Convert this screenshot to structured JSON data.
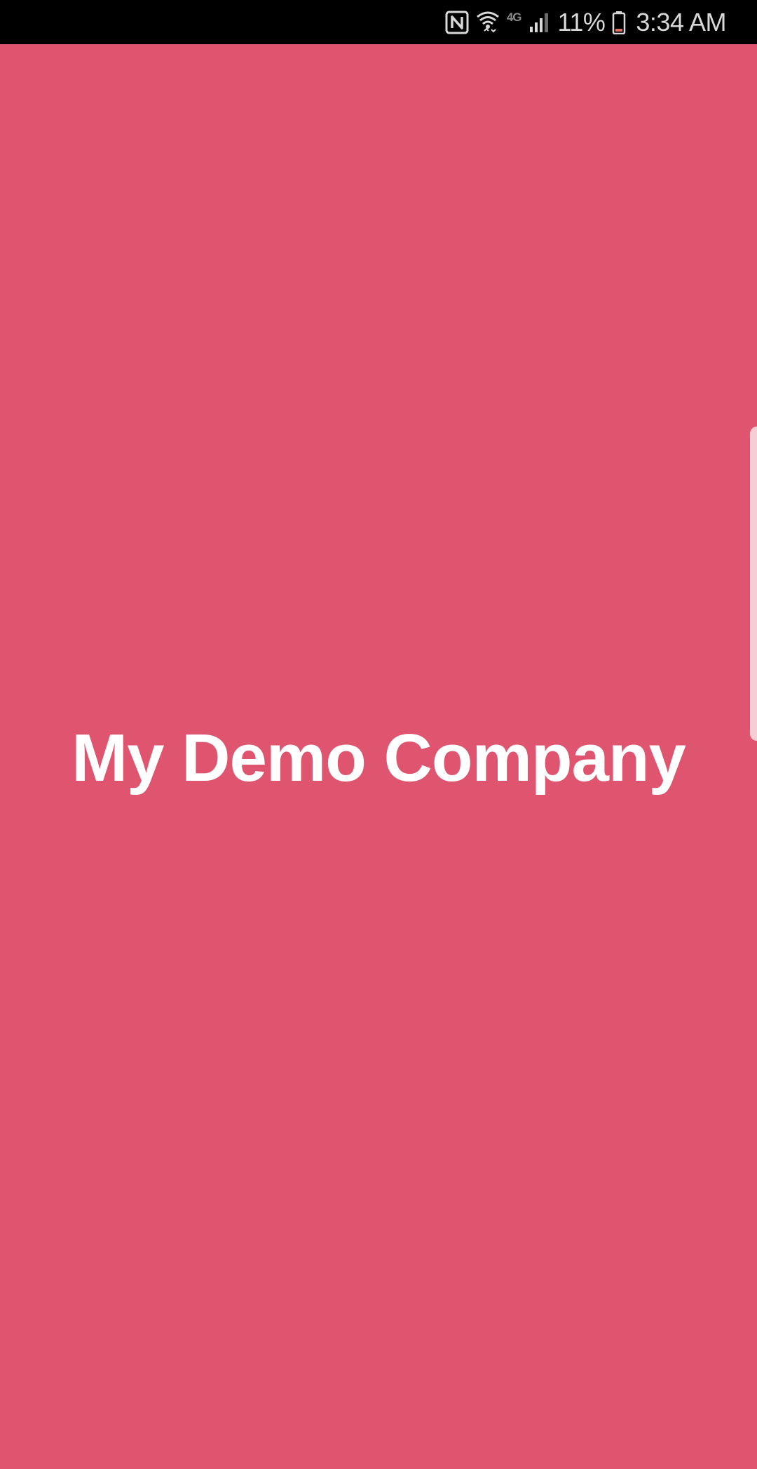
{
  "status_bar": {
    "icons": [
      "nfc-icon",
      "wifi-icon",
      "lte-icon",
      "signal-icon",
      "battery-icon"
    ],
    "network_label": "4G",
    "battery_percent": "11%",
    "time": "3:34 AM"
  },
  "splash": {
    "title": "My Demo Company"
  },
  "colors": {
    "background": "#df546e",
    "status_bar": "#000000",
    "title_text": "#ffffff",
    "edge_handle": "#f7d3da"
  }
}
